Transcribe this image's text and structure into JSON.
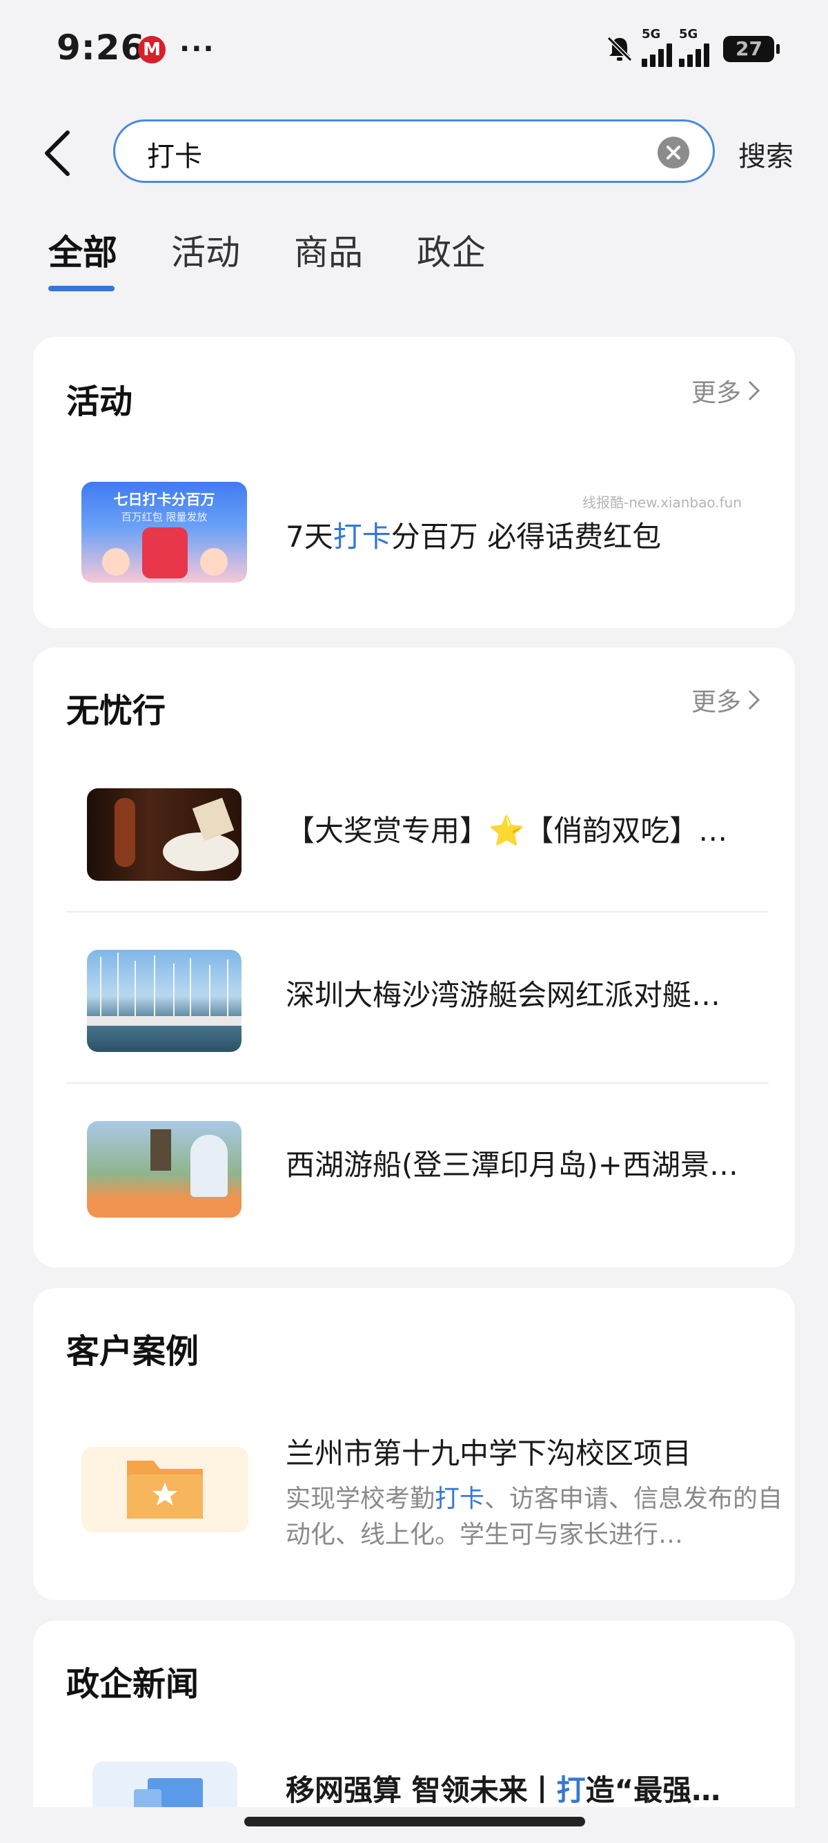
{
  "status_bar": {
    "time": "9:26",
    "sim1": "5G",
    "sim2": "5G",
    "battery": "27"
  },
  "search": {
    "query": "打卡",
    "button_label": "搜索"
  },
  "tabs": [
    {
      "label": "全部",
      "active": true
    },
    {
      "label": "活动",
      "active": false
    },
    {
      "label": "商品",
      "active": false
    },
    {
      "label": "政企",
      "active": false
    }
  ],
  "more_label": "更多",
  "watermark": "线报酷-new.xianbao.fun",
  "sections": {
    "activity": {
      "title": "活动",
      "banner_line1": "七日打卡分百万",
      "banner_line2": "百万红包 限量发放",
      "item_before": "7天",
      "item_highlight": "打卡",
      "item_after": "分百万 必得话费红包"
    },
    "wuyouxing": {
      "title": "无忧行",
      "items": [
        {
          "title": "【大奖赏专用】⭐【俏韵双吃】…"
        },
        {
          "title": "深圳大梅沙湾游艇会网红派对艇…"
        },
        {
          "title": "西湖游船(登三潭印月岛)+西湖景…"
        }
      ]
    },
    "cases": {
      "title": "客户案例",
      "item_title": "兰州市第十九中学下沟校区项目",
      "desc_before": "实现学校考勤",
      "desc_highlight": "打卡",
      "desc_after": "、访客申请、信息发布的自动化、线上化。学生可与家长进行…"
    },
    "news": {
      "title": "政企新闻",
      "item_before": "移网强算 智领未来丨",
      "item_highlight": "打",
      "item_after": "造“最强…"
    }
  },
  "colors": {
    "accent": "#3478d4",
    "background": "#f3f3f5",
    "muted": "#8a8a8a"
  }
}
